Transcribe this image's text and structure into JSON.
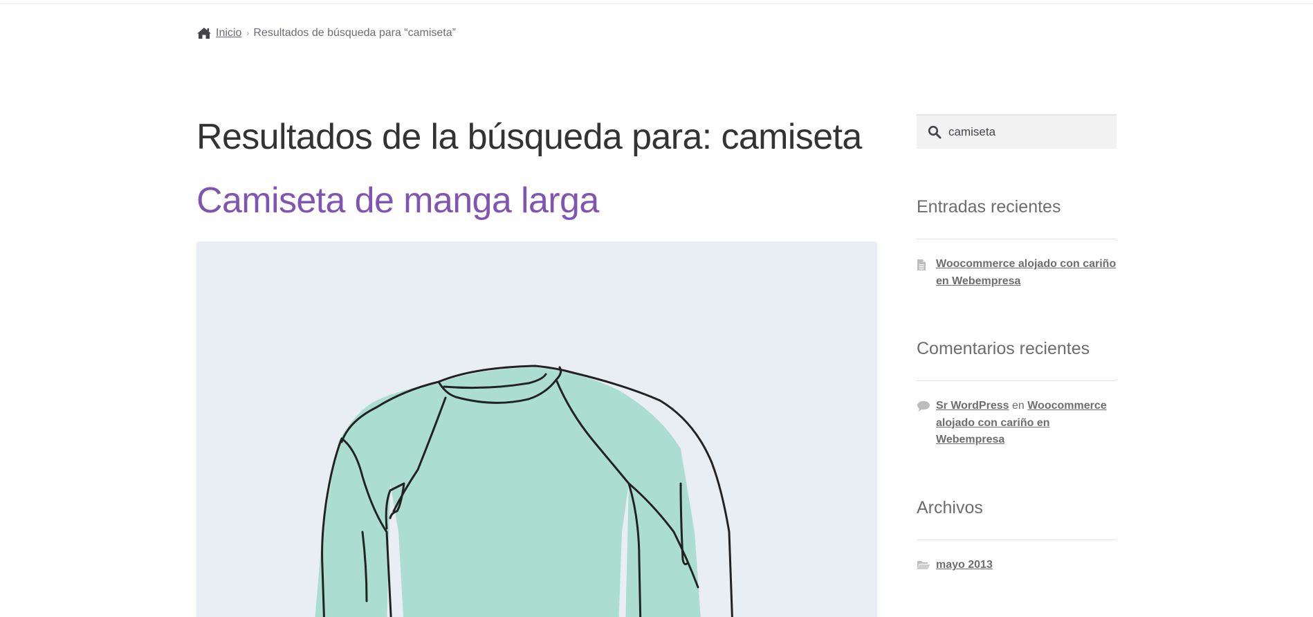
{
  "breadcrumb": {
    "home_label": "Inicio",
    "current": "Resultados de búsqueda para “camiseta”"
  },
  "page": {
    "title": "Resultados de la búsqueda para: camiseta"
  },
  "results": [
    {
      "title": "Camiseta de manga larga",
      "image": "long-sleeve-shirt-illustration"
    }
  ],
  "sidebar": {
    "search": {
      "value": "camiseta",
      "icon": "search-icon"
    },
    "recent_posts": {
      "title": "Entradas recientes",
      "items": [
        {
          "label": "Woocommerce alojado con cariño en Webempresa",
          "icon": "document-icon"
        }
      ]
    },
    "recent_comments": {
      "title": "Comentarios recientes",
      "items": [
        {
          "author": "Sr WordPress",
          "connector": "en",
          "post": "Woocommerce alojado con cariño en Webempresa",
          "icon": "comment-icon"
        }
      ]
    },
    "archives": {
      "title": "Archivos",
      "items": [
        {
          "label": "mayo 2013",
          "icon": "folder-icon"
        }
      ]
    }
  },
  "colors": {
    "accent": "#7f54b3",
    "text": "#43454b",
    "muted": "#6d6d6d",
    "image_bg": "#e9eef2",
    "shirt": "#a8dccf"
  }
}
